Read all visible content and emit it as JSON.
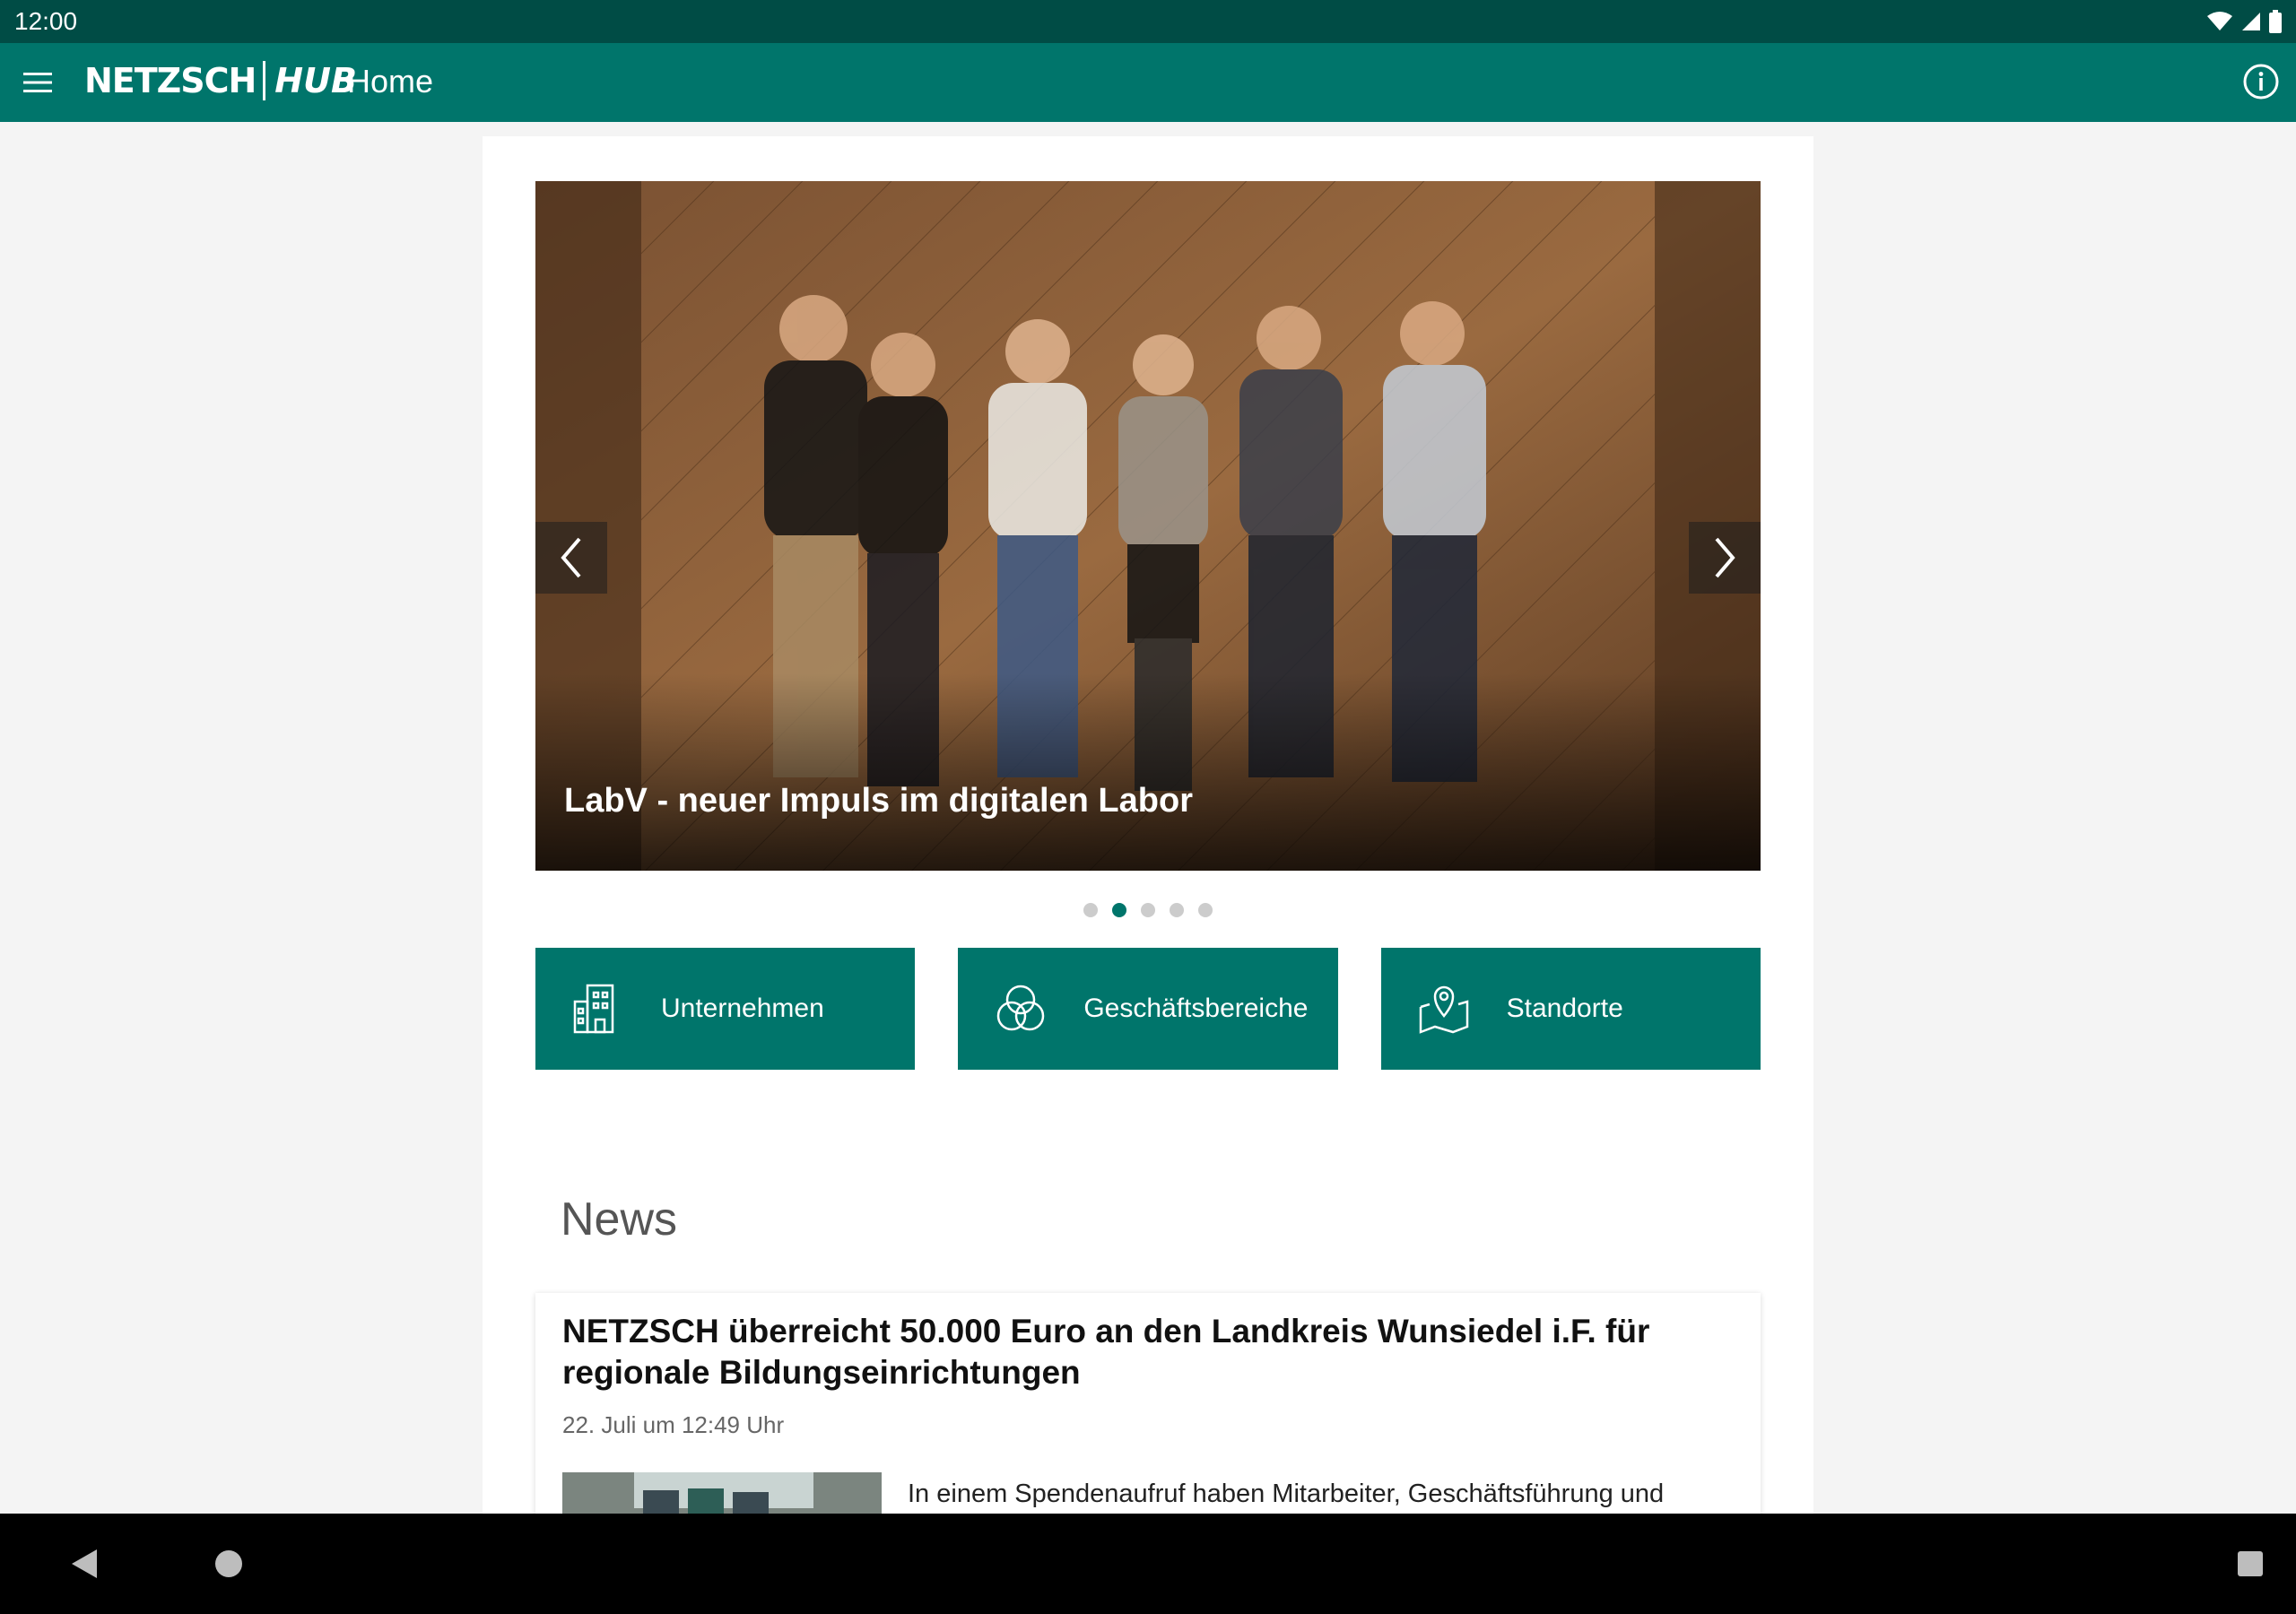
{
  "status_bar": {
    "time": "12:00"
  },
  "app_bar": {
    "logo_left": "NETZSCH",
    "logo_right": "HUB",
    "title": "Home"
  },
  "carousel": {
    "caption": "LabV - neuer Impuls im digitalen Labor",
    "slide_count": 5,
    "active_index": 1
  },
  "tiles": [
    {
      "label": "Unternehmen",
      "icon": "building-icon"
    },
    {
      "label": "Geschäftsbereiche",
      "icon": "venn-circles-icon"
    },
    {
      "label": "Standorte",
      "icon": "map-pin-icon"
    }
  ],
  "news": {
    "heading": "News",
    "items": [
      {
        "title": "NETZSCH überreicht 50.000 Euro an den Landkreis Wunsiedel i.F. für regionale Bildungseinrichtungen",
        "date": "22. Juli um 12:49 Uhr",
        "excerpt": "In einem Spendenaufruf haben Mitarbeiter, Geschäftsführung und"
      }
    ]
  },
  "colors": {
    "primary": "#00756b",
    "status_bar": "#004c45"
  }
}
